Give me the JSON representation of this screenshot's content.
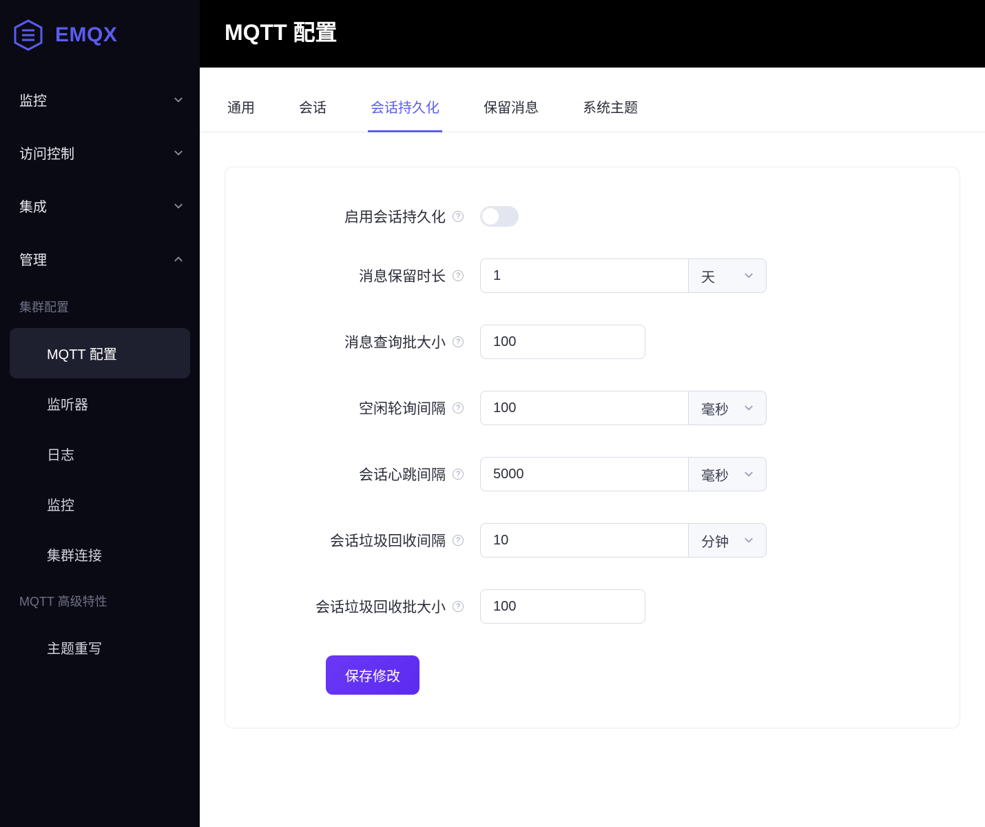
{
  "brand": "EMQX",
  "sidebar": {
    "groups": [
      {
        "label": "监控",
        "expanded": false
      },
      {
        "label": "访问控制",
        "expanded": false
      },
      {
        "label": "集成",
        "expanded": false
      },
      {
        "label": "管理",
        "expanded": true
      }
    ],
    "manage": {
      "section1_header": "集群配置",
      "items1": [
        {
          "label": "MQTT 配置",
          "active": true
        },
        {
          "label": "监听器"
        },
        {
          "label": "日志"
        },
        {
          "label": "监控"
        },
        {
          "label": "集群连接"
        }
      ],
      "section2_header": "MQTT 高级特性",
      "items2": [
        {
          "label": "主题重写"
        }
      ]
    }
  },
  "page_title": "MQTT 配置",
  "tabs": [
    {
      "label": "通用"
    },
    {
      "label": "会话"
    },
    {
      "label": "会话持久化",
      "active": true
    },
    {
      "label": "保留消息"
    },
    {
      "label": "系统主题"
    }
  ],
  "form": {
    "enable": {
      "label": "启用会话持久化",
      "value": false
    },
    "retention": {
      "label": "消息保留时长",
      "value": "1",
      "unit": "天"
    },
    "batch_size": {
      "label": "消息查询批大小",
      "value": "100"
    },
    "idle_poll": {
      "label": "空闲轮询间隔",
      "value": "100",
      "unit": "毫秒"
    },
    "heartbeat": {
      "label": "会话心跳间隔",
      "value": "5000",
      "unit": "毫秒"
    },
    "gc_interval": {
      "label": "会话垃圾回收间隔",
      "value": "10",
      "unit": "分钟"
    },
    "gc_batch": {
      "label": "会话垃圾回收批大小",
      "value": "100"
    }
  },
  "save_button": "保存修改"
}
